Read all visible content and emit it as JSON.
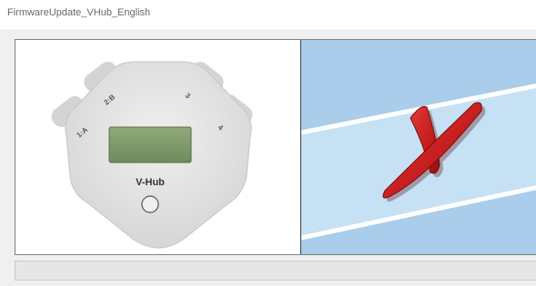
{
  "window": {
    "title": "FirmwareUpdate_VHub_English"
  },
  "device": {
    "name": "V-Hub",
    "ports": {
      "port_1": "1:A",
      "port_2": "2:B",
      "port_3": "3",
      "port_4": "4"
    }
  },
  "status": {
    "icon": "red-x-error-icon",
    "error_color": "#cc1a1a",
    "background_color": "#a9cdea"
  }
}
